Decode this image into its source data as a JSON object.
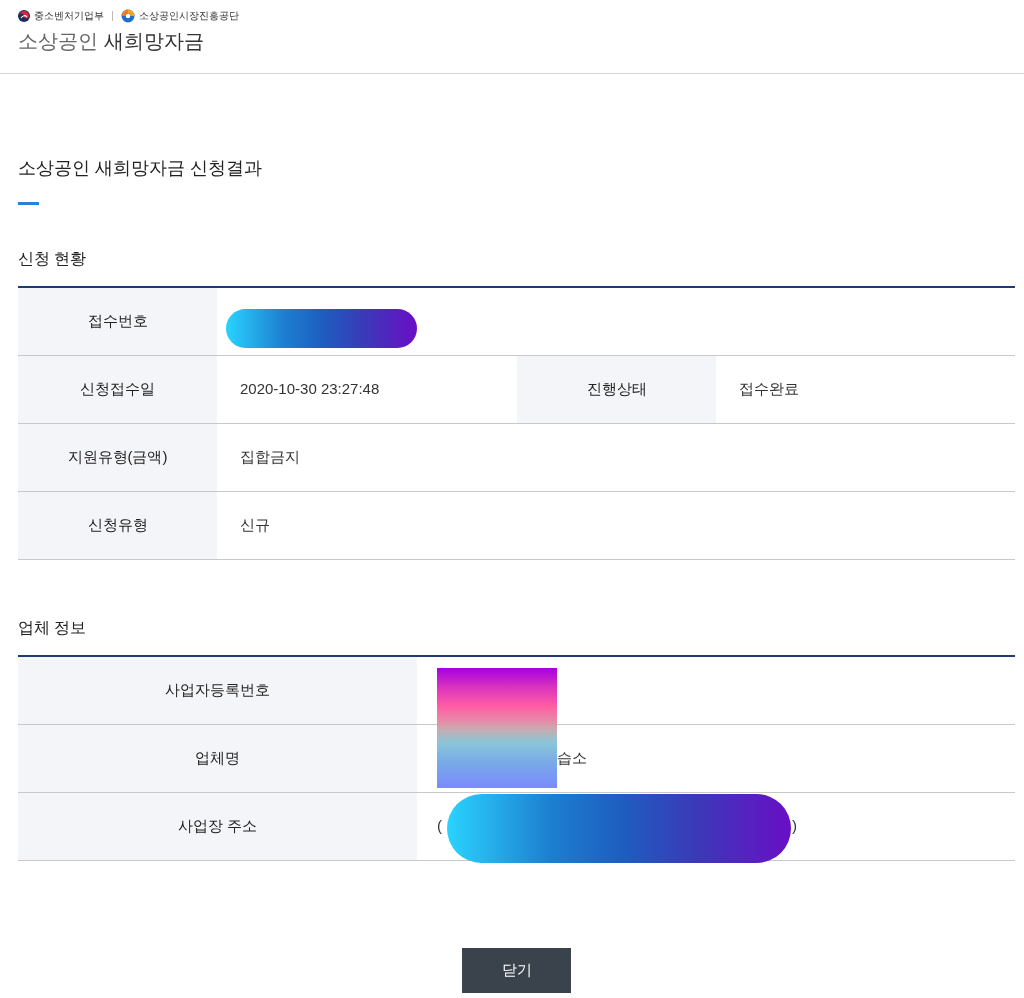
{
  "header": {
    "logos": [
      {
        "label": "중소벤처기업부"
      },
      {
        "label": "소상공인시장진흥공단"
      }
    ],
    "title_prefix": "소상공인",
    "title": "새희망자금"
  },
  "page_title": "소상공인 새희망자금 신청결과",
  "sections": [
    {
      "heading": "신청 현황",
      "rows": [
        {
          "cells": [
            {
              "label": "접수번호",
              "kind": "pill"
            }
          ]
        },
        {
          "cells": [
            {
              "label": "신청접수일",
              "value": "2020-10-30 23:27:48",
              "kind": "plain"
            },
            {
              "label": "진행상태",
              "value": "접수완료",
              "kind": "plain"
            }
          ]
        },
        {
          "cells": [
            {
              "label": "지원유형(금액)",
              "value": "집합금지",
              "kind": "plain"
            }
          ]
        },
        {
          "cells": [
            {
              "label": "신청유형",
              "value": "신규",
              "kind": "plain"
            }
          ]
        }
      ]
    },
    {
      "heading": "업체 정보",
      "rows": [
        {
          "cells": [
            {
              "label": "사업자등록번호",
              "kind": "block"
            }
          ]
        },
        {
          "cells": [
            {
              "label": "업체명",
              "value": "습소",
              "kind": "covered"
            }
          ]
        },
        {
          "cells": [
            {
              "label": "사업장 주소",
              "value_before": "(",
              "value_after": ")",
              "kind": "wide"
            }
          ]
        }
      ]
    }
  ],
  "buttons": [
    {
      "label": "닫기"
    }
  ]
}
